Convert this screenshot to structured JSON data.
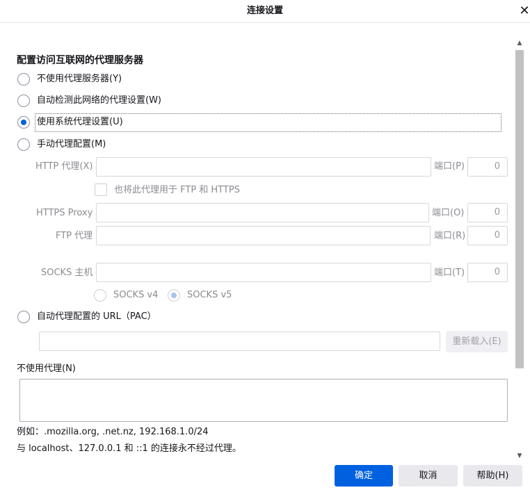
{
  "dialog": {
    "title": "连接设置",
    "close_glyph": "✕"
  },
  "section_title": "配置访问互联网的代理服务器",
  "proxy_modes": [
    {
      "label": "不使用代理服务器(Y)",
      "selected": false
    },
    {
      "label": "自动检测此网络的代理设置(W)",
      "selected": false
    },
    {
      "label": "使用系统代理设置(U)",
      "selected": true
    },
    {
      "label": "手动代理配置(M)",
      "selected": false
    }
  ],
  "manual": {
    "http_label": "HTTP 代理(X)",
    "http_value": "",
    "port_label_http": "端口(P)",
    "http_port": "0",
    "also_use_label": "也将此代理用于 FTP 和 HTTPS",
    "https_label": "HTTPS Proxy",
    "https_value": "",
    "port_label_https": "端口(O)",
    "https_port": "0",
    "ftp_label": "FTP 代理",
    "ftp_value": "",
    "port_label_ftp": "端口(R)",
    "ftp_port": "0",
    "socks_label": "SOCKS 主机",
    "socks_value": "",
    "port_label_socks": "端口(T)",
    "socks_port": "0",
    "socks_v4": "SOCKS v4",
    "socks_v5": "SOCKS v5",
    "socks_version_selected": "v5"
  },
  "pac": {
    "label": "自动代理配置的 URL（PAC）",
    "value": "",
    "reload_button": "重新载入(E)"
  },
  "no_proxy": {
    "label": "不使用代理(N)",
    "value": "",
    "example": "例如：.mozilla.org, .net.nz, 192.168.1.0/24",
    "note": "与 localhost、127.0.0.1 和 ::1 的连接永不经过代理。"
  },
  "buttons": {
    "ok": "确定",
    "cancel": "取消",
    "help": "帮助(H)"
  },
  "colors": {
    "accent": "#0061e0",
    "disabled_text": "#8b8b91"
  }
}
